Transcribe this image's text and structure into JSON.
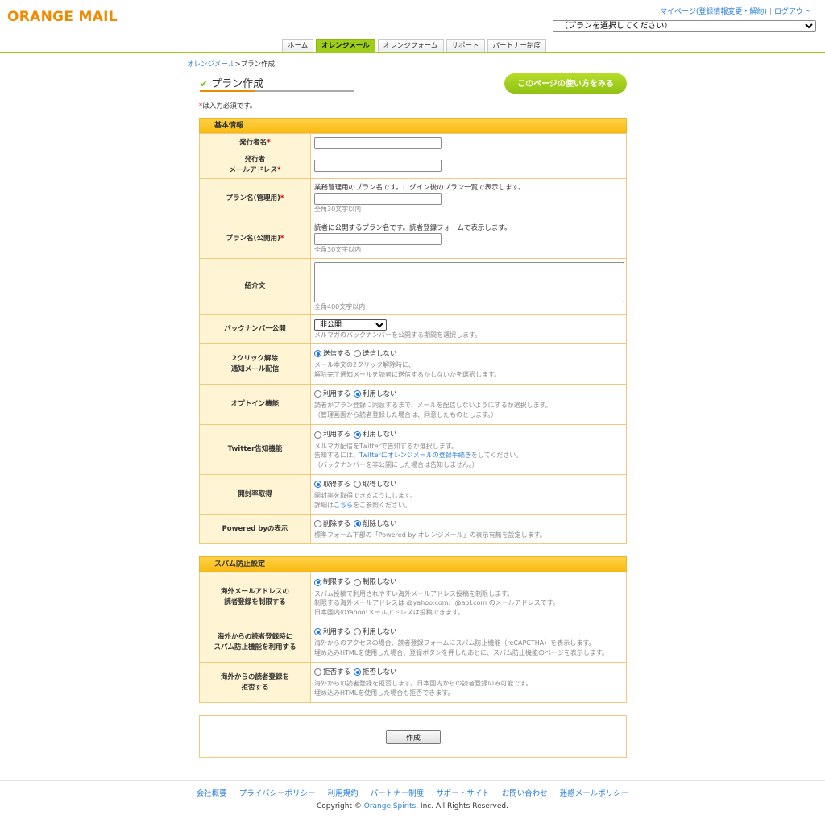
{
  "header": {
    "logo": "ORANGE MAIL",
    "mypage_link": "マイページ(登録情報変更・解約)",
    "logout_link": "ログアウト",
    "plan_select_value": "（プランを選択してください）"
  },
  "nav": {
    "tabs": [
      "ホーム",
      "オレンジメール",
      "オレンジフォーム",
      "サポート",
      "パートナー制度"
    ],
    "active_index": 1
  },
  "breadcrumb": {
    "parent": "オレンジメール",
    "current": ">プラン作成"
  },
  "page": {
    "title": "プラン作成",
    "help_button": "このページの使い方をみる",
    "required_mark": "*",
    "required_note": "は入力必須です。"
  },
  "basic": {
    "header": "基本情報",
    "publisher_name_label": "発行者名",
    "publisher_email_label_1": "発行者",
    "publisher_email_label_2": "メールアドレス",
    "plan_admin_label": "プラン名(管理用)",
    "plan_admin_desc": "業務管理用のプラン名です。ログイン後のプラン一覧で表示します。",
    "plan_admin_hint": "全角30文字以内",
    "plan_public_label": "プラン名(公開用)",
    "plan_public_desc": "読者に公開するプラン名です。読者登録フォームで表示します。",
    "plan_public_hint": "全角30文字以内",
    "intro_label": "紹介文",
    "intro_hint": "全角400文字以内",
    "backnumber_label": "バックナンバー公開",
    "backnumber_value": "非公開",
    "backnumber_hint": "メルマガのバックナンバーを公開する期間を選択します。",
    "twoclick_label_1": "2クリック解除",
    "twoclick_label_2": "通知メール配信",
    "twoclick_opt_on": "送信する",
    "twoclick_opt_off": "送信しない",
    "twoclick_hint_1": "メール本文の2クリック解除時に、",
    "twoclick_hint_2": "解除完了通知メールを読者に送信するかしないかを選択します。",
    "optin_label": "オプトイン機能",
    "optin_opt_on": "利用する",
    "optin_opt_off": "利用しない",
    "optin_hint_1": "読者がプラン登録に同意するまで、メールを配信しないようにするか選択します。",
    "optin_hint_2": "（管理画面から読者登録した場合は、同意したものとします。）",
    "twitter_label": "Twitter告知機能",
    "twitter_opt_on": "利用する",
    "twitter_opt_off": "利用しない",
    "twitter_hint_1": "メルマガ配信をTwitterで告知するか選択します。",
    "twitter_hint_2a": "告知するには、",
    "twitter_hint_link": "Twitterにオレンジメールの登録手続き",
    "twitter_hint_2b": "をしてください。",
    "twitter_hint_3": "（バックナンバーを非公開にした場合は告知しません。）",
    "openrate_label": "開封率取得",
    "openrate_opt_on": "取得する",
    "openrate_opt_off": "取得しない",
    "openrate_hint_1": "開封率を取得できるようにします。",
    "openrate_hint_2a": "詳細は",
    "openrate_hint_link": "こちら",
    "openrate_hint_2b": "をご参照ください。",
    "poweredby_label": "Powered byの表示",
    "poweredby_opt_on": "削除する",
    "poweredby_opt_off": "削除しない",
    "poweredby_hint": "標準フォーム下部の「Powered by オレンジメール」の表示有無を設定します。"
  },
  "spam": {
    "header": "スパム防止設定",
    "foreign_email_label_1": "海外メールアドレスの",
    "foreign_email_label_2": "読者登録を制限する",
    "foreign_email_opt_on": "制限する",
    "foreign_email_opt_off": "制限しない",
    "foreign_email_hint_1": "スパム投稿で利用されやすい海外メールアドレス投稿を制限します。",
    "foreign_email_hint_2": "制限する海外メールアドレスは @yahoo.com、@aol.com のメールアドレスです。",
    "foreign_email_hint_3": "日本国内のYahoo!メールアドレスは投稿できます。",
    "foreign_captcha_label_1": "海外からの読者登録時に",
    "foreign_captcha_label_2": "スパム防止機能を利用する",
    "foreign_captcha_opt_on": "利用する",
    "foreign_captcha_opt_off": "利用しない",
    "foreign_captcha_hint_1": "海外からのアクセスの場合、読者登録フォームにスパム防止機能（reCAPCTHA）を表示します。",
    "foreign_captcha_hint_2": "埋め込みHTMLを使用した場合、登録ボタンを押したあとに、スパム防止機能のページを表示します。",
    "foreign_reject_label_1": "海外からの読者登録を",
    "foreign_reject_label_2": "拒否する",
    "foreign_reject_opt_on": "拒否する",
    "foreign_reject_opt_off": "拒否しない",
    "foreign_reject_hint_1": "海外からの読者登録を拒否します。日本国内からの読者登録のみ可能です。",
    "foreign_reject_hint_2": "埋め込みHTMLを使用した場合も拒否できます。"
  },
  "submit_label": "作成",
  "footer": {
    "links": [
      "会社概要",
      "プライバシーポリシー",
      "利用規約",
      "パートナー制度",
      "サポートサイト",
      "お問い合わせ",
      "迷惑メールポリシー"
    ],
    "copyright_prefix": "Copyright ©",
    "copyright_brand": "Orange Spirits",
    "copyright_suffix": ", Inc. All Rights Reserved."
  },
  "colors": {
    "brand_orange": "#f28a00",
    "accent_green": "#9fce1a",
    "section_yellow": "#f9bb12",
    "label_bg": "#fff4d4"
  }
}
